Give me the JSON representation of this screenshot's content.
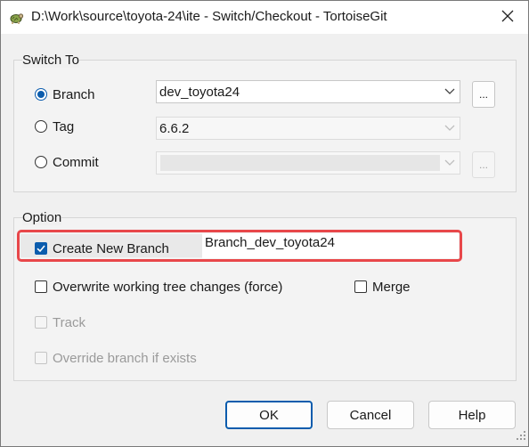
{
  "window": {
    "title": "D:\\Work\\source\\toyota-24\\ite - Switch/Checkout - TortoiseGit"
  },
  "switch_to": {
    "group_label": "Switch To",
    "branch": {
      "label": "Branch",
      "selected": true,
      "value": "dev_toyota24"
    },
    "tag": {
      "label": "Tag",
      "selected": false,
      "value": "6.6.2"
    },
    "commit": {
      "label": "Commit",
      "selected": false,
      "value": ""
    },
    "browse_label": "..."
  },
  "option": {
    "group_label": "Option",
    "create_new_branch": {
      "label": "Create New Branch",
      "checked": true,
      "value": "Branch_dev_toyota24"
    },
    "overwrite": {
      "label": "Overwrite working tree changes (force)",
      "checked": false
    },
    "merge": {
      "label": "Merge",
      "checked": false
    },
    "track": {
      "label": "Track",
      "checked": false,
      "disabled": true
    },
    "override": {
      "label": "Override branch if exists",
      "checked": false,
      "disabled": true
    }
  },
  "buttons": {
    "ok_label": "OK",
    "cancel_label": "Cancel",
    "help_label": "Help"
  },
  "colors": {
    "accent": "#0b5cad",
    "highlight": "#e8474a"
  },
  "icons": {
    "app": "tortoisegit-icon",
    "close": "close-icon",
    "dropdown": "chevron-down-icon",
    "check": "check-icon",
    "resize": "resize-grip-icon"
  }
}
